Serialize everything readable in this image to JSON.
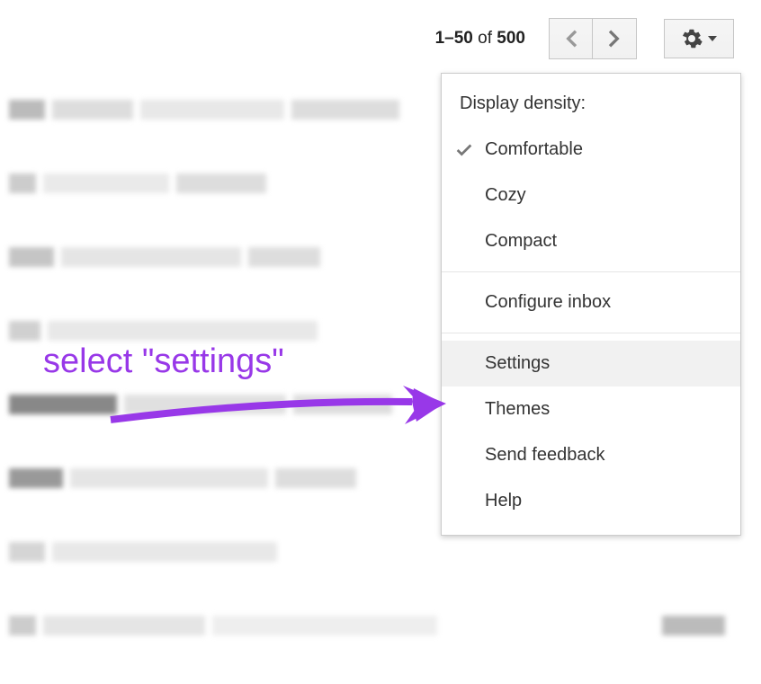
{
  "toolbar": {
    "pagination": {
      "range": "1–50",
      "of_word": "of",
      "total": "500"
    }
  },
  "menu": {
    "density_label": "Display density:",
    "density_options": {
      "comfortable": "Comfortable",
      "cozy": "Cozy",
      "compact": "Compact"
    },
    "configure_inbox": "Configure inbox",
    "settings": "Settings",
    "themes": "Themes",
    "send_feedback": "Send feedback",
    "help": "Help"
  },
  "annotation": {
    "text": "select \"settings\"",
    "color": "#9838e8"
  }
}
